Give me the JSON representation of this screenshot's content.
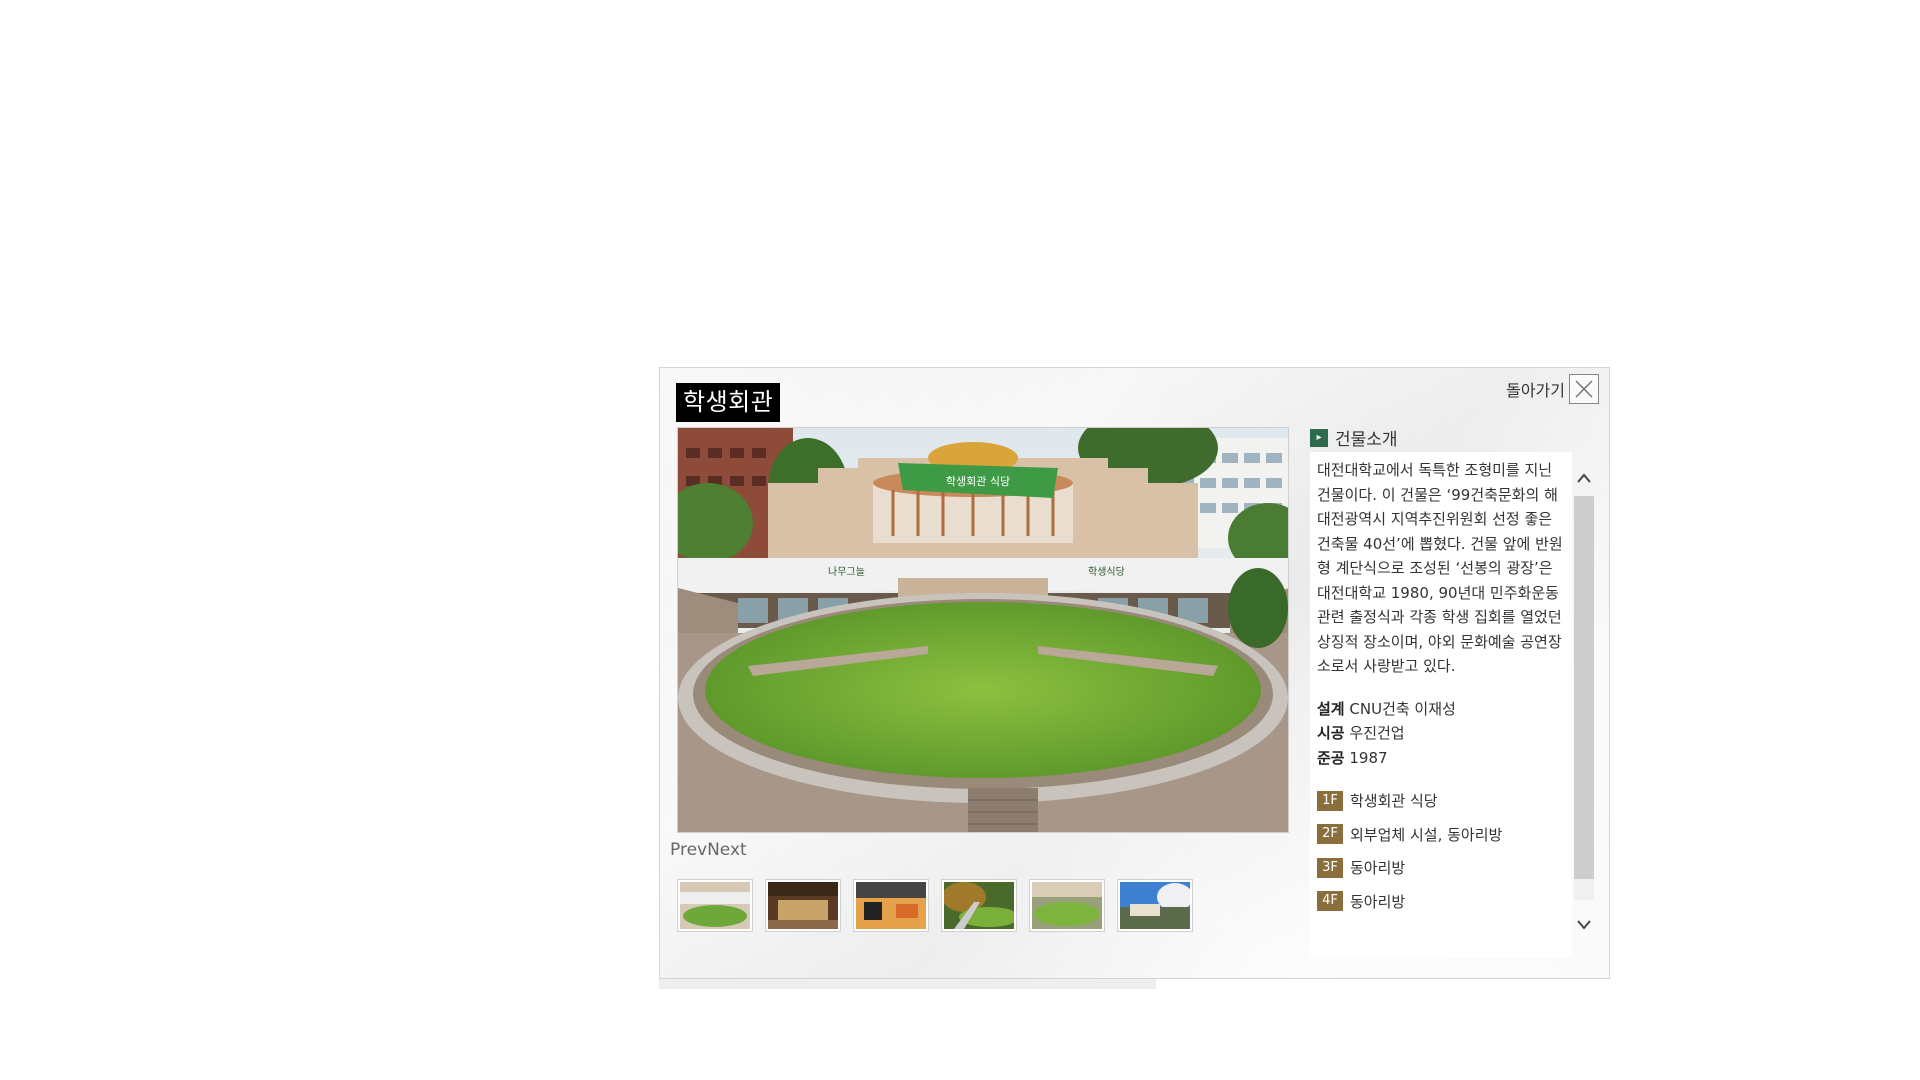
{
  "popup": {
    "title": "학생회관",
    "back_label": "돌아가기"
  },
  "gallery": {
    "prev_label": "Prev",
    "next_label": "Next",
    "thumbnail_count": 6
  },
  "info": {
    "section_label": "건물소개",
    "description": "대전대학교에서 독특한 조형미를 지닌 건물이다. 이 건물은 ‘99건축문화의 해 대전광역시 지역추진위원회 선정 좋은 건축물 40선’에 뽑혔다. 건물 앞에 반원형 계단식으로 조성된 ‘선봉의 광장’은 대전대학교 1980, 90년대 민주화운동 관련 출정식과 각종 학생 집회를 열었던 상징적 장소이며, 야외 문화예술 공연장소로서 사랑받고 있다.",
    "design_label": "설계",
    "design_value": "CNU건축 이재성",
    "construction_label": "시공",
    "construction_value": "우진건업",
    "completion_label": "준공",
    "completion_value": "1987",
    "floors": [
      {
        "badge": "1F",
        "text": "학생회관 식당"
      },
      {
        "badge": "2F",
        "text": "외부업체 시설, 동아리방"
      },
      {
        "badge": "3F",
        "text": "동아리방"
      },
      {
        "badge": "4F",
        "text": "동아리방"
      }
    ]
  },
  "photo_signs": {
    "banner": "학생회관 식당",
    "left_sign": "나무그늘",
    "right_sign": "학생식당"
  },
  "colors": {
    "title_bg": "#000000",
    "bullet_green": "#2e6b4c",
    "floor_badge": "#8a6f3c"
  },
  "icons": {
    "close": "close-x-icon",
    "bullet": "arrow-bullet-icon",
    "scroll_up": "chevron-up-icon",
    "scroll_down": "chevron-down-icon"
  }
}
